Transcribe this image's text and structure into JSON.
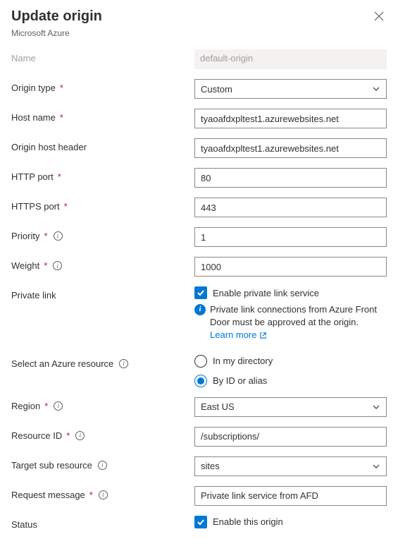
{
  "header": {
    "title": "Update origin",
    "subtitle": "Microsoft Azure"
  },
  "labels": {
    "name": "Name",
    "origin_type": "Origin type",
    "host_name": "Host name",
    "origin_host_header": "Origin host header",
    "http_port": "HTTP port",
    "https_port": "HTTPS port",
    "priority": "Priority",
    "weight": "Weight",
    "private_link": "Private link",
    "select_resource": "Select an Azure resource",
    "region": "Region",
    "resource_id": "Resource ID",
    "target_sub_resource": "Target sub resource",
    "request_message": "Request message",
    "status": "Status"
  },
  "values": {
    "name": "default-origin",
    "origin_type": "Custom",
    "host_name": "tyaoafdxpltest1.azurewebsites.net",
    "origin_host_header": "tyaoafdxpltest1.azurewebsites.net",
    "http_port": "80",
    "https_port": "443",
    "priority": "1",
    "weight": "1000",
    "region": "East US",
    "resource_id": "/subscriptions/",
    "target_sub_resource": "sites",
    "request_message": "Private link service from AFD"
  },
  "privateLink": {
    "enable_label": "Enable private link service",
    "info_text": "Private link connections from Azure Front Door must be approved at the origin.",
    "learn_more": "Learn more"
  },
  "radio": {
    "in_directory": "In my directory",
    "by_id": "By ID or alias"
  },
  "status_checkbox": "Enable this origin"
}
